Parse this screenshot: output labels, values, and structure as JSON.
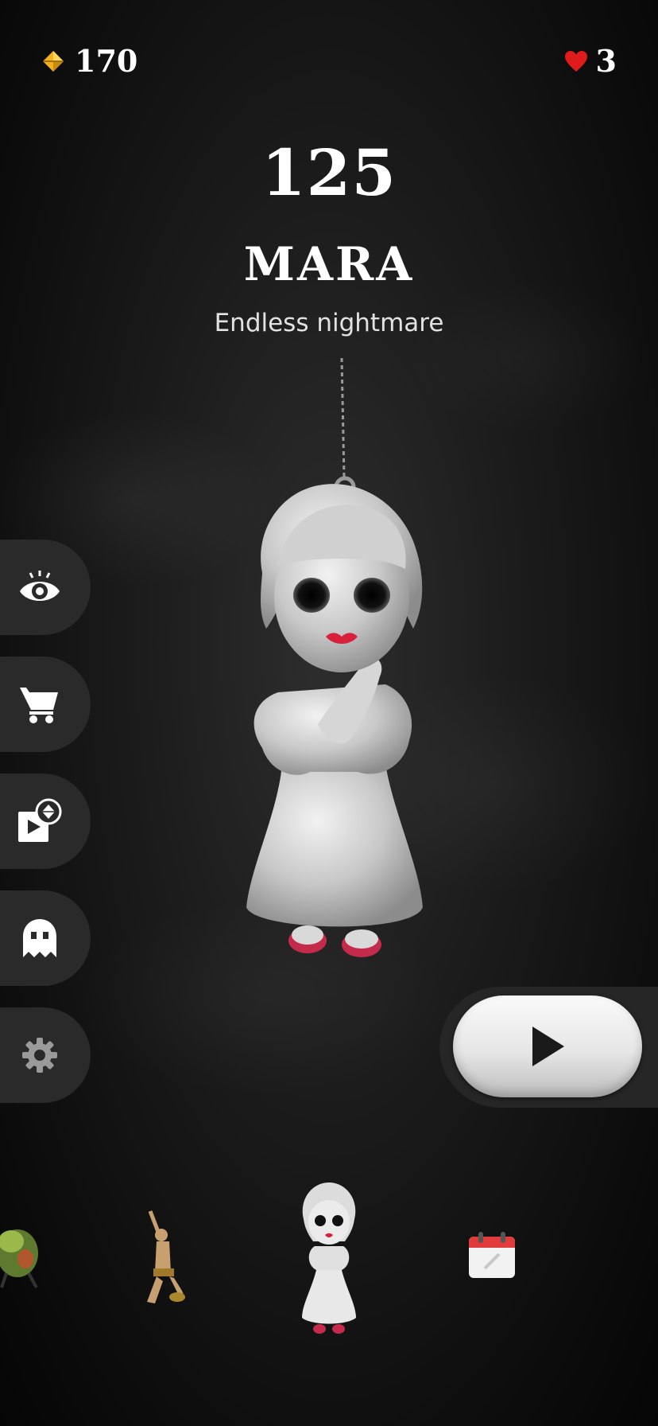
{
  "hud": {
    "gems": "170",
    "lives": "3",
    "gem_icon": "gem-icon",
    "heart_icon": "heart-icon"
  },
  "level": {
    "number": "125",
    "name": "MARA",
    "subtitle": "Endless nightmare"
  },
  "side_menu": [
    {
      "name": "eye-button",
      "icon": "eye-icon"
    },
    {
      "name": "shop-button",
      "icon": "cart-icon"
    },
    {
      "name": "watch-ad-gems-button",
      "icon": "video-gem-icon"
    },
    {
      "name": "ghost-button",
      "icon": "ghost-icon"
    },
    {
      "name": "settings-button",
      "icon": "gear-icon"
    }
  ],
  "play_button": {
    "icon": "play-icon"
  },
  "carousel": [
    {
      "name": "monster-fly",
      "icon": "fly-creature-icon"
    },
    {
      "name": "monster-warrior",
      "icon": "warrior-figure-icon"
    },
    {
      "name": "monster-mara",
      "icon": "doll-icon",
      "selected": true
    },
    {
      "name": "daily-calendar",
      "icon": "calendar-icon"
    }
  ],
  "colors": {
    "background": "#0e0e0e",
    "side_button": "#2a2a2a",
    "heart": "#e01b1b",
    "gem": "#f0b020",
    "doll": "#d9d9d9",
    "lips": "#d8203a"
  }
}
